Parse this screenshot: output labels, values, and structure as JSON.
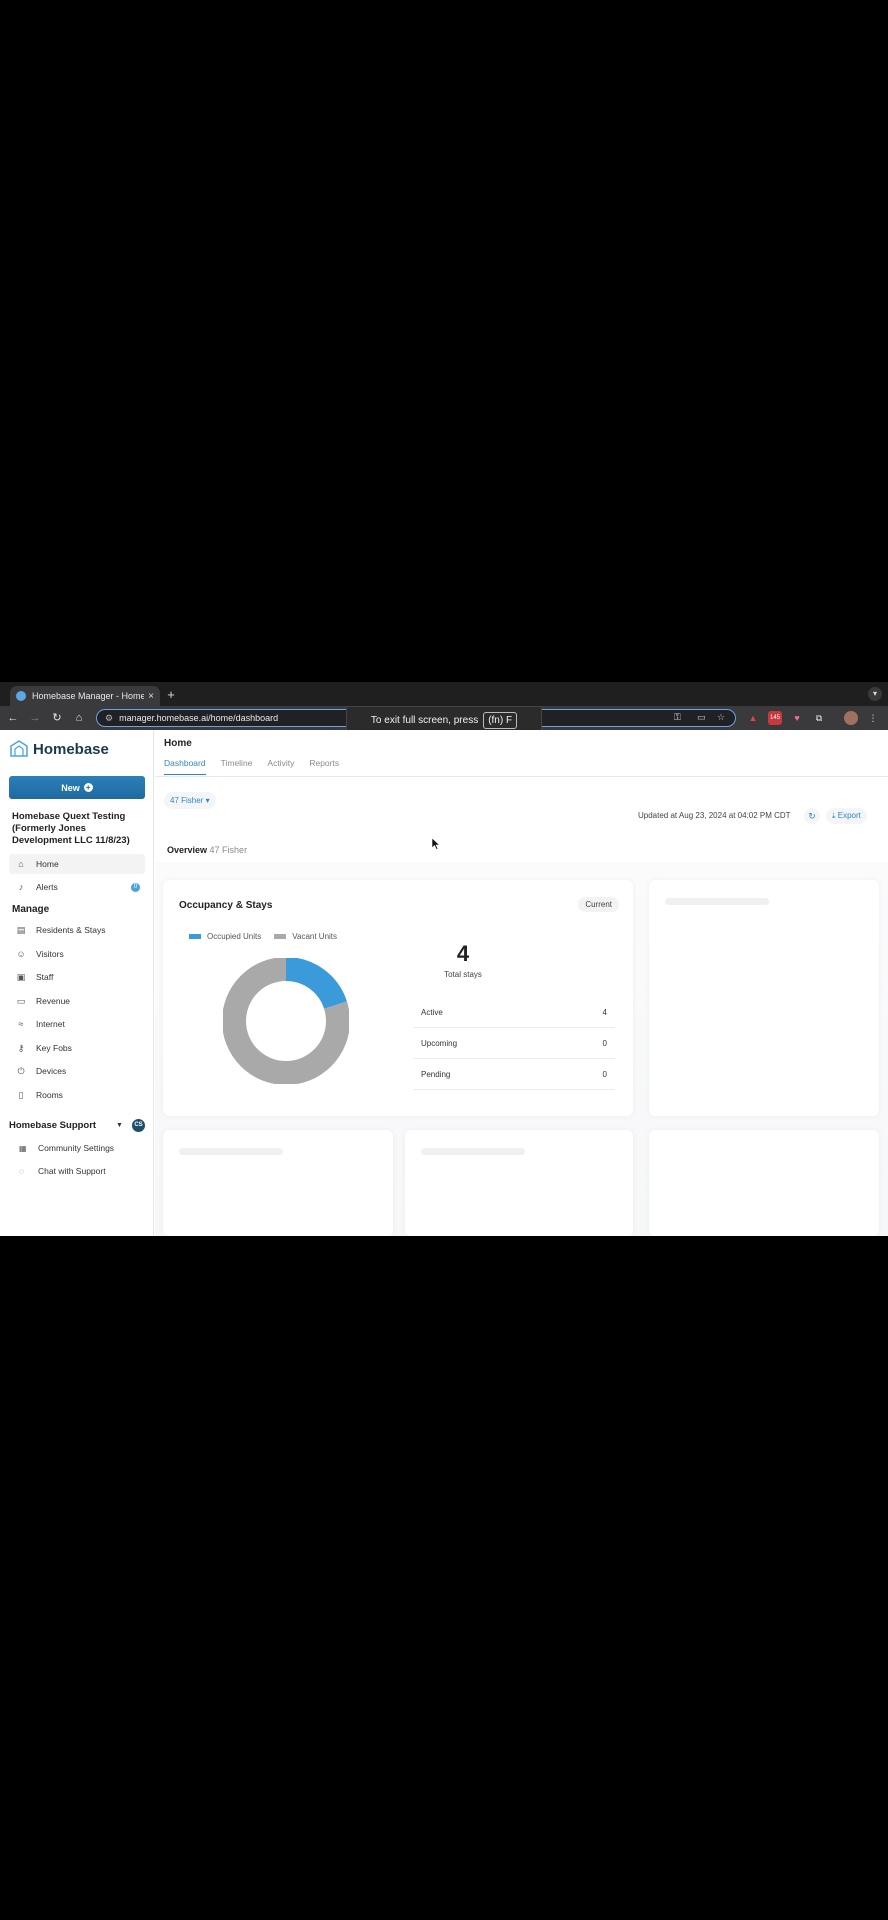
{
  "browser": {
    "tab_title": "Homebase Manager - Home",
    "tab_close": "×",
    "new_tab": "+",
    "url": "manager.homebase.ai/home/dashboard",
    "toast_text": "To exit full screen, press",
    "toast_key": "(fn) F",
    "ext_badge": "145"
  },
  "app": {
    "logo": "Homebase",
    "new_button": "New",
    "community_name": "Homebase Quext Testing (Formerly Jones Development LLC 11/8/23)",
    "nav_top": [
      {
        "label": "Home",
        "icon": "home-icon"
      },
      {
        "label": "Alerts",
        "icon": "bell-icon",
        "badge": "0"
      }
    ],
    "manage_title": "Manage",
    "nav_manage": [
      {
        "label": "Residents & Stays",
        "icon": "residents-icon"
      },
      {
        "label": "Visitors",
        "icon": "visitors-icon"
      },
      {
        "label": "Staff",
        "icon": "staff-icon"
      },
      {
        "label": "Revenue",
        "icon": "revenue-icon"
      },
      {
        "label": "Internet",
        "icon": "wifi-icon"
      },
      {
        "label": "Key Fobs",
        "icon": "key-icon"
      },
      {
        "label": "Devices",
        "icon": "power-icon"
      },
      {
        "label": "Rooms",
        "icon": "door-icon"
      }
    ],
    "support_title": "Homebase Support",
    "support_avatar": "CS",
    "support_items": [
      {
        "label": "Community Settings",
        "icon": "building-icon"
      },
      {
        "label": "Chat with Support",
        "icon": "chat-icon"
      }
    ]
  },
  "main": {
    "title": "Home",
    "tabs": [
      "Dashboard",
      "Timeline",
      "Activity",
      "Reports"
    ],
    "property_pill": "47 Fisher ▾",
    "updated": "Updated at Aug 23, 2024 at 04:02 PM CDT",
    "export": "⤓ Export",
    "overview_title": "Overview",
    "overview_property": "47 Fisher"
  },
  "occupancy": {
    "title": "Occupancy & Stays",
    "filter": "Current",
    "legend_occupied": "Occupied Units",
    "legend_vacant": "Vacant Units",
    "total_stays": "4",
    "total_caption": "Total stays",
    "rows": [
      {
        "label": "Active",
        "value": "4"
      },
      {
        "label": "Upcoming",
        "value": "0"
      },
      {
        "label": "Pending",
        "value": "0"
      }
    ]
  },
  "chart_data": {
    "type": "pie",
    "categories": [
      "Occupied Units",
      "Vacant Units"
    ],
    "values": [
      0.2,
      0.8
    ],
    "colors": [
      "#3b9ad9",
      "#a9a9a9"
    ],
    "title": "Occupancy & Stays"
  }
}
